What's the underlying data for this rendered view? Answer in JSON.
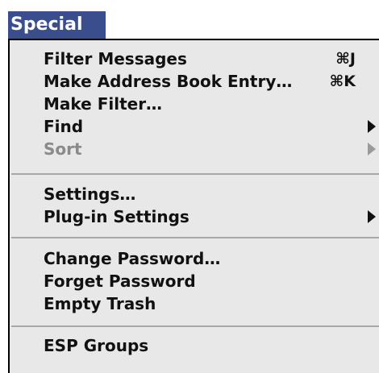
{
  "menu": {
    "title": "Special",
    "groups": [
      [
        {
          "label": "Filter Messages",
          "shortcut": "⌘J",
          "submenu": false,
          "enabled": true
        },
        {
          "label": "Make Address Book Entry…",
          "shortcut": "⌘K",
          "submenu": false,
          "enabled": true
        },
        {
          "label": "Make Filter…",
          "shortcut": "",
          "submenu": false,
          "enabled": true
        },
        {
          "label": "Find",
          "shortcut": "",
          "submenu": true,
          "enabled": true
        },
        {
          "label": "Sort",
          "shortcut": "",
          "submenu": true,
          "enabled": false
        }
      ],
      [
        {
          "label": "Settings…",
          "shortcut": "",
          "submenu": false,
          "enabled": true
        },
        {
          "label": "Plug-in Settings",
          "shortcut": "",
          "submenu": true,
          "enabled": true
        }
      ],
      [
        {
          "label": "Change Password…",
          "shortcut": "",
          "submenu": false,
          "enabled": true
        },
        {
          "label": "Forget Password",
          "shortcut": "",
          "submenu": false,
          "enabled": true
        },
        {
          "label": "Empty Trash",
          "shortcut": "",
          "submenu": false,
          "enabled": true
        }
      ],
      [
        {
          "label": "ESP Groups",
          "shortcut": "",
          "submenu": false,
          "enabled": true
        }
      ]
    ]
  },
  "icons": {
    "submenu_arrow": "triangle-right-icon"
  },
  "colors": {
    "title_bg": "#3a4e8e",
    "title_fg": "#ffffff",
    "menu_bg": "#e8e8e8",
    "disabled": "#8a8a8a"
  }
}
